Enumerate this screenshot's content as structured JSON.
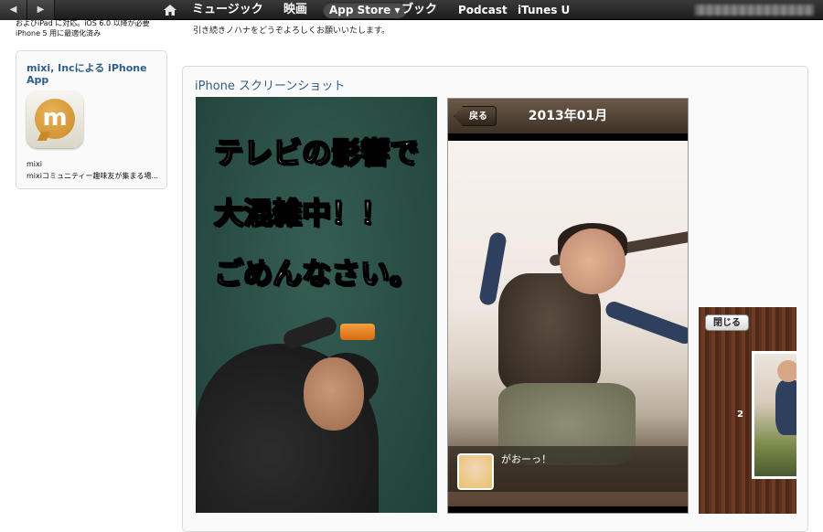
{
  "topbar": {
    "nav": [
      {
        "label": "ミュージック"
      },
      {
        "label": "映画"
      },
      {
        "label": "App Store ▾"
      },
      {
        "label": "ブック"
      },
      {
        "label": "Podcast"
      },
      {
        "label": "iTunes U"
      }
    ],
    "icons": {
      "back": "chevron-left-icon",
      "forward": "chevron-right-icon",
      "home": "home-icon"
    },
    "colors": {
      "bar": "#1c1c1c",
      "text": "#ffffff",
      "selected": "#4c4c4c"
    }
  },
  "compat": {
    "line1": "およびiPad に対応。iOS 6.0 以降が必要",
    "line2": "iPhone 5 用に最適化済み"
  },
  "description_tail": "引き続きノハナをどうぞよろしくお願いいたします。",
  "sidebar": {
    "title": "mixi, Incによる iPhone App",
    "app_icon": "mixi-app-icon",
    "app_name": "mixi",
    "app_subtitle": "mixiコミュニティー趣味友が集まる場..."
  },
  "screenshots": {
    "heading": "iPhone スクリーンショット",
    "shot1": {
      "lines": [
        "テレビの影響で",
        "大混雑中！！",
        "ごめんなさい。"
      ]
    },
    "shot2": {
      "back_label": "戻る",
      "title": "2013年01月",
      "caption": "がおーっ！"
    },
    "shot3": {
      "close_label": "閉じる",
      "page_number": "2"
    }
  },
  "colors": {
    "link": "#2f5d8a",
    "chalkboard": "#2e5548",
    "wood": "#5a301e"
  }
}
